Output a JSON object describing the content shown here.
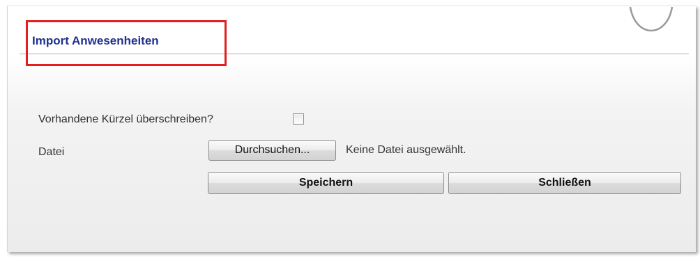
{
  "dialog": {
    "title": "Import Anwesenheiten"
  },
  "form": {
    "overwrite_label": "Vorhandene Kürzel überschreiben?",
    "overwrite_checked": false,
    "file_label": "Datei",
    "browse_button_label": "Durchsuchen...",
    "file_status": "Keine Datei ausgewählt."
  },
  "actions": {
    "save_label": "Speichern",
    "close_label": "Schließen"
  },
  "colors": {
    "title": "#1f2f8c",
    "highlight_border": "#e02020",
    "title_rule": "#c9a0a6"
  }
}
